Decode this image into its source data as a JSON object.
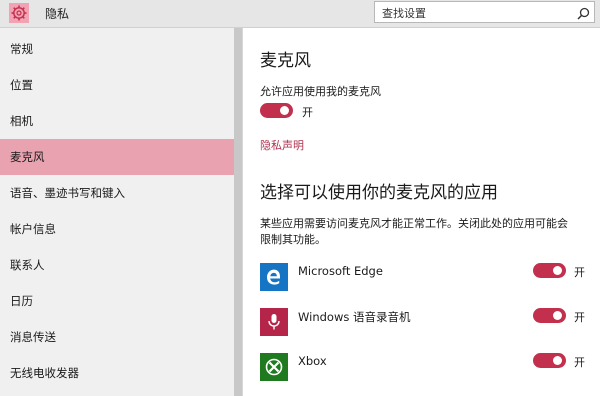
{
  "header": {
    "title": "隐私",
    "search_placeholder": "查找设置",
    "gear_icon": "gear-icon",
    "search_icon": "search-icon"
  },
  "sidebar": {
    "items": [
      {
        "label": "常规",
        "active": false
      },
      {
        "label": "位置",
        "active": false
      },
      {
        "label": "相机",
        "active": false
      },
      {
        "label": "麦克风",
        "active": true
      },
      {
        "label": "语音、墨迹书写和键入",
        "active": false
      },
      {
        "label": "帐户信息",
        "active": false
      },
      {
        "label": "联系人",
        "active": false
      },
      {
        "label": "日历",
        "active": false
      },
      {
        "label": "消息传送",
        "active": false
      },
      {
        "label": "无线电收发器",
        "active": false
      }
    ]
  },
  "main": {
    "title": "麦克风",
    "allow_label": "允许应用使用我的麦克风",
    "allow_toggle_state": "开",
    "privacy_link": "隐私声明",
    "apps_title": "选择可以使用你的麦克风的应用",
    "apps_desc_line1": "某些应用需要访问麦克风才能正常工作。关闭此处的应用可能会",
    "apps_desc_line2": "限制其功能。",
    "apps": [
      {
        "name": "Microsoft Edge",
        "toggle": "开",
        "icon": "edge-icon",
        "color": "#1574c4"
      },
      {
        "name": "Windows 语音录音机",
        "toggle": "开",
        "icon": "microphone-icon",
        "color": "#b5254a"
      },
      {
        "name": "Xbox",
        "toggle": "开",
        "icon": "xbox-icon",
        "color": "#1f7a1f"
      }
    ]
  },
  "colors": {
    "accent": "#c2304d",
    "active_nav": "#e8a2b0",
    "link": "#b0324f"
  }
}
